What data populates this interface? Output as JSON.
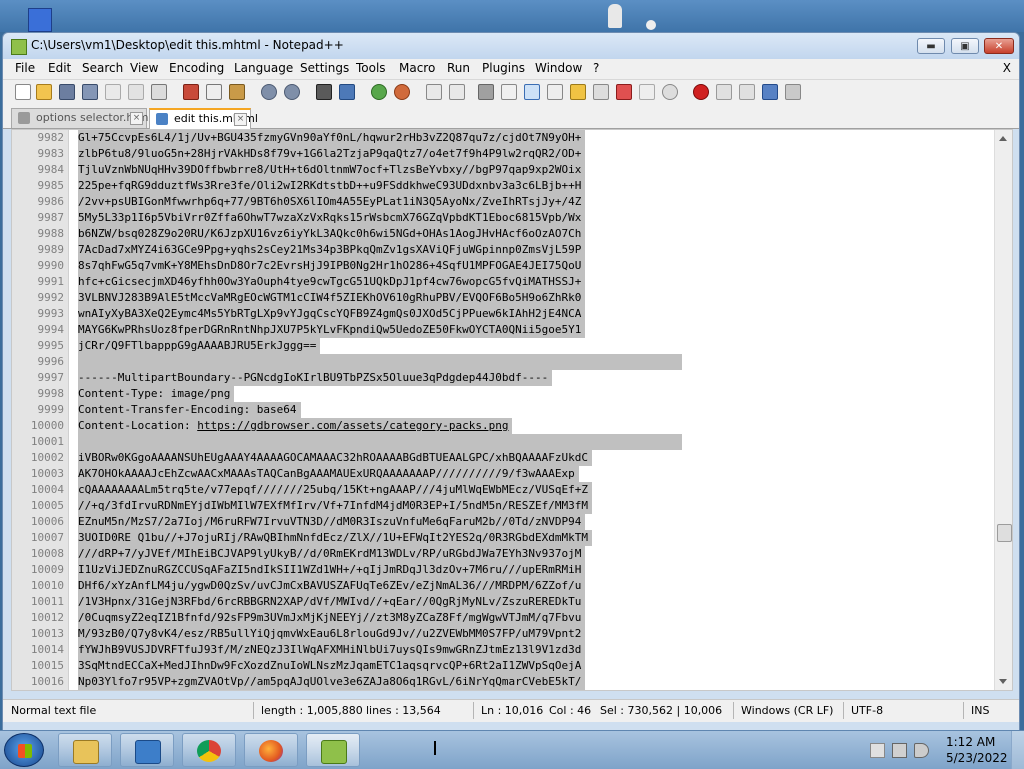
{
  "window": {
    "title": "C:\\Users\\vm1\\Desktop\\edit this.mhtml - Notepad++",
    "min_label": "▬",
    "max_label": "▣",
    "close_label": "✕"
  },
  "menu": [
    "File",
    "Edit",
    "Search",
    "View",
    "Encoding",
    "Language",
    "Settings",
    "Tools",
    "Macro",
    "Run",
    "Plugins",
    "Window",
    "?"
  ],
  "menu_close": "X",
  "tabs": [
    {
      "label": "options selector.html",
      "active": false
    },
    {
      "label": "edit this.mhtml",
      "active": true
    }
  ],
  "lines": [
    {
      "n": "9982",
      "t": "Gl+75CcvpEs6L4/1j/Uv+BGU435fzmyGVn90aYf0nL/hqwur2rHb3vZ2Q87qu7z/cjdOt7N9yOH+"
    },
    {
      "n": "9983",
      "t": "zlbP6tu8/9luoG5n+28HjrVAkHDs8f79v+1G6la2TzjaP9qaQtz7/o4et7f9h4P9lw2rqQR2/OD+"
    },
    {
      "n": "9984",
      "t": "TjluVznWbNUqHHv39DOffbwbrre8/UtH+t6dOltnmW7ocf+TlzsBeYvbxy//bgP97qap9xp2WOix"
    },
    {
      "n": "9985",
      "t": "225pe+fqRG9dduztfWs3Rre3fe/Oli2wI2RKdtstbD++u9FSddkhweC93UDdxnbv3a3c6LBjb++H"
    },
    {
      "n": "9986",
      "t": "/2vv+psUBIGonMfwwrhp6q+77/9BT6h0SX6lIOm4A55EyPLat1iN3Q5AyoNx/ZveIhRTsjJy+/4Z"
    },
    {
      "n": "9987",
      "t": "5My5L33p1I6p5VbiVrr0Zffa6OhwT7wzaXzVxRqks15rWsbcmX76GZqVpbdKT1Eboc6815Vpb/Wx"
    },
    {
      "n": "9988",
      "t": "b6NZW/bsq028Z9o20RU/K6JzpXU16vz6iyYkL3AQkc0h6wi5NGd+OHAs1AogJHvHAcf6oOzAO7Ch"
    },
    {
      "n": "9989",
      "t": "7AcDad7xMYZ4i63GCe9Ppg+yqhs2sCey21Ms34p3BPkqQmZv1gsXAViQFjuWGpinnp0ZmsVjL59P"
    },
    {
      "n": "9990",
      "t": "8s7qhFwG5q7vmK+Y8MEhsDnD8Or7c2EvrsHjJ9IPB0Ng2Hr1hO286+4SqfU1MPFOGAE4JEI75QoU"
    },
    {
      "n": "9991",
      "t": "hfc+cGicsecjmXD46yfhh0Ow3YaOuph4tye9cwTgcG51UQkDpJ1pf4cw76wopcG5fvQiMATHSSJ+"
    },
    {
      "n": "9992",
      "t": "3VLBNVJ283B9AlE5tMccVaMRgEOcWGTM1cCIW4f5ZIEKhOV610gRhuPBV/EVQOF6Bo5H9o6ZhRk0"
    },
    {
      "n": "9993",
      "t": "wnAIyXyBA3XeQ2Eymc4Ms5YbRTgLXp9vYJgqCscYQFB9Z4gmQs0JXOd5CjPPuew6kIAhH2jE4NCA"
    },
    {
      "n": "9994",
      "t": "MAYG6KwPRhsUoz8fperDGRnRntNhpJXU7P5kYLvFKpndiQw5UedoZE50FkwOYCTA0QNii5goe5Y1"
    },
    {
      "n": "9995",
      "t": "jCRr/Q9FTlbapppG9gAAAABJRU5ErkJggg=="
    },
    {
      "n": "9996",
      "t": ""
    },
    {
      "n": "9997",
      "t": "------MultipartBoundary--PGNcdgIoKIrlBU9TbPZSx5Oluue3qPdgdep44J0bdf----"
    },
    {
      "n": "9998",
      "t": "Content-Type: image/png"
    },
    {
      "n": "9999",
      "t": "Content-Transfer-Encoding: base64"
    },
    {
      "n": "10000",
      "t": "Content-Location: ",
      "link": "https://gdbrowser.com/assets/category-packs.png"
    },
    {
      "n": "10001",
      "t": ""
    },
    {
      "n": "10002",
      "t": "iVBORw0KGgoAAAANSUhEUgAAAY4AAAAGOCAMAAAC32hROAAAABGdBTUEAALGPC/xhBQAAAAFzUkdC"
    },
    {
      "n": "10003",
      "t": "AK7OHOkAAAAJcEhZcwAACxMAAAsTAQCanBgAAAMAUExURQAAAAAAAP//////////9/f3wAAAExp"
    },
    {
      "n": "10004",
      "t": "cQAAAAAAAALm5trq5te/v77epqf///////25ubq/15Kt+ngAAAP///4juMlWqEWbMEcz/VUSqEf+Z"
    },
    {
      "n": "10005",
      "t": "//+q/3fdIrvuRDNmEYjdIWbMIlW7EXfMfIrv/Vf+7InfdM4jdM0R3EP+I/5ndM5n/RESZEf/MM3fM"
    },
    {
      "n": "10006",
      "t": "EZnuM5n/MzS7/2a7Ioj/M6ruRFW7IrvuVTN3D//dM0R3IszuVnfuMe6qFaruM2b//0Td/zNVDP94"
    },
    {
      "n": "10007",
      "t": "3UOID0RE Q1bu//+J7ojuRIj/RAwQBIhmNnfdEcz/ZlX//1U+EFWqIt2YES2q/0R3RGbdEXdmMkTM"
    },
    {
      "n": "10008",
      "t": "///dRP+7/yJVEf/MIhEiBCJVAP9lyUkyB//d/0RmEKrdM13WDLv/RP/uRGbdJWa7EYh3Nv937ojM"
    },
    {
      "n": "10009",
      "t": "I1UzViJEDZnuRGZCCUSqAFaZI5ndIkSII1WZd1WH+/+qIjJmRDqJl3dzOv+7M6ru///upERmRMiH"
    },
    {
      "n": "10010",
      "t": "DHf6/xYzAnfLM4ju/ygwD0QzSv/uvCJmCxBAVUSZAFUqTe6ZEv/eZjNmAL36///MRDPM/6ZZof/u"
    },
    {
      "n": "10011",
      "t": "/1V3Hpnx/31GejN3RFbd/6rcRBBGRN2XAP/dVf/MWIvd//+qEar//0QgRjMyNLv/ZszuREREDkTu"
    },
    {
      "n": "10012",
      "t": "/0CuqmsyZ2eqIZ1Bfnfd/92sFP9m3UVmJxMjKjNEEYj//zt3M8yZCaZ8Ff/mgWgwVTJmM/q7Fbvu"
    },
    {
      "n": "10013",
      "t": "M/93zB0/Q7y8vK4/esz/RB5ullYiQjqmvWxEau6L8rlouGd9Jv//u2ZVEWbMM0S7FP/uM79Vpnt2"
    },
    {
      "n": "10014",
      "t": "fYWJhB9VUSJDVRFTfuJ93f/M/zNEQzJ3IlWqAFXMHiNlbUi7uysQIs9mwGRnZJtmEz13l9V1zd3d"
    },
    {
      "n": "10015",
      "t": "3SqMtndECCaX+MedJIhnDw9FcXozdZnuIoWLNszMzJqamETC1aqsqrvcQP+6Rt2aI1ZWVpSqOejA"
    },
    {
      "n": "10016",
      "t": "Np03Ylfo7r95VP+zgmZVAOtVp//am5pqAJqUOlve3e6ZAJa8O6q1RGvL/6iNrYqQmarCVebE5kT/"
    }
  ],
  "status": {
    "type": "Normal text file",
    "length": "length : 1,005,880",
    "lines": "lines : 13,564",
    "ln": "Ln : 10,016",
    "col": "Col : 46",
    "sel": "Sel : 730,562 | 10,006",
    "eol": "Windows (CR LF)",
    "encoding": "UTF-8",
    "mode": "INS"
  },
  "clock": {
    "time": "1:12 AM",
    "date": "5/23/2022"
  },
  "taskbar_apps": [
    "file-explorer-icon",
    "media-player-icon",
    "chrome-icon",
    "firefox-icon",
    "notepadpp-icon"
  ],
  "colors": {
    "selection": "#c0c0c0",
    "tab_accent": "#f5a623",
    "taskbar": "#8fb0d3"
  }
}
